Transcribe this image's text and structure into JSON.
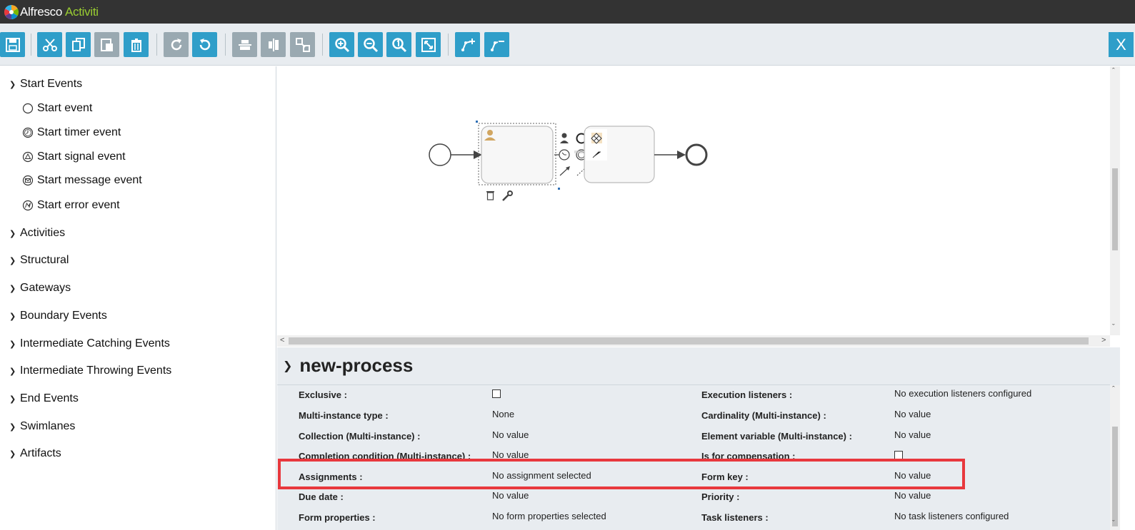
{
  "header": {
    "brand": "Alfresco",
    "product": "Activiti"
  },
  "toolbar": {
    "close_label": "X",
    "buttons": [
      "save-icon",
      "cut-icon",
      "copy-icon",
      "paste-icon",
      "delete-icon",
      "redo-icon",
      "undo-icon",
      "align-horizontal-icon",
      "align-vertical-icon",
      "same-size-icon",
      "zoom-in-icon",
      "zoom-out-icon",
      "zoom-actual-icon",
      "zoom-fit-icon",
      "bend-add-icon",
      "bend-remove-icon"
    ]
  },
  "palette": {
    "groups": [
      {
        "label": "Start Events",
        "expanded": true
      },
      {
        "label": "Activities"
      },
      {
        "label": "Structural"
      },
      {
        "label": "Gateways"
      },
      {
        "label": "Boundary Events"
      },
      {
        "label": "Intermediate Catching Events"
      },
      {
        "label": "Intermediate Throwing Events"
      },
      {
        "label": "End Events"
      },
      {
        "label": "Swimlanes"
      },
      {
        "label": "Artifacts"
      }
    ],
    "start_events": [
      {
        "label": "Start event",
        "icon": "circle-icon"
      },
      {
        "label": "Start timer event",
        "icon": "timer-icon"
      },
      {
        "label": "Start signal event",
        "icon": "signal-icon"
      },
      {
        "label": "Start message event",
        "icon": "message-icon"
      },
      {
        "label": "Start error event",
        "icon": "error-icon"
      }
    ]
  },
  "properties": {
    "title": "new-process",
    "rows": [
      {
        "left_label": "Exclusive :",
        "left_value": "",
        "left_checkbox": true,
        "right_label": "Execution listeners :",
        "right_value": "No execution listeners configured"
      },
      {
        "left_label": "Multi-instance type :",
        "left_value": "None",
        "right_label": "Cardinality (Multi-instance) :",
        "right_value": "No value"
      },
      {
        "left_label": "Collection (Multi-instance) :",
        "left_value": "No value",
        "right_label": "Element variable (Multi-instance) :",
        "right_value": "No value"
      },
      {
        "left_label": "Completion condition (Multi-instance) :",
        "left_value": "No value",
        "right_label": "Is for compensation :",
        "right_value": "",
        "right_checkbox": true
      },
      {
        "left_label": "Assignments :",
        "left_value": "No assignment selected",
        "right_label": "Form key :",
        "right_value": "No value"
      },
      {
        "left_label": "Due date :",
        "left_value": "No value",
        "right_label": "Priority :",
        "right_value": "No value"
      },
      {
        "left_label": "Form properties :",
        "left_value": "No form properties selected",
        "right_label": "Task listeners :",
        "right_value": "No task listeners configured"
      }
    ]
  },
  "colors": {
    "accent": "#2f9ec9",
    "highlight": "#e8383d",
    "header": "#333333"
  }
}
